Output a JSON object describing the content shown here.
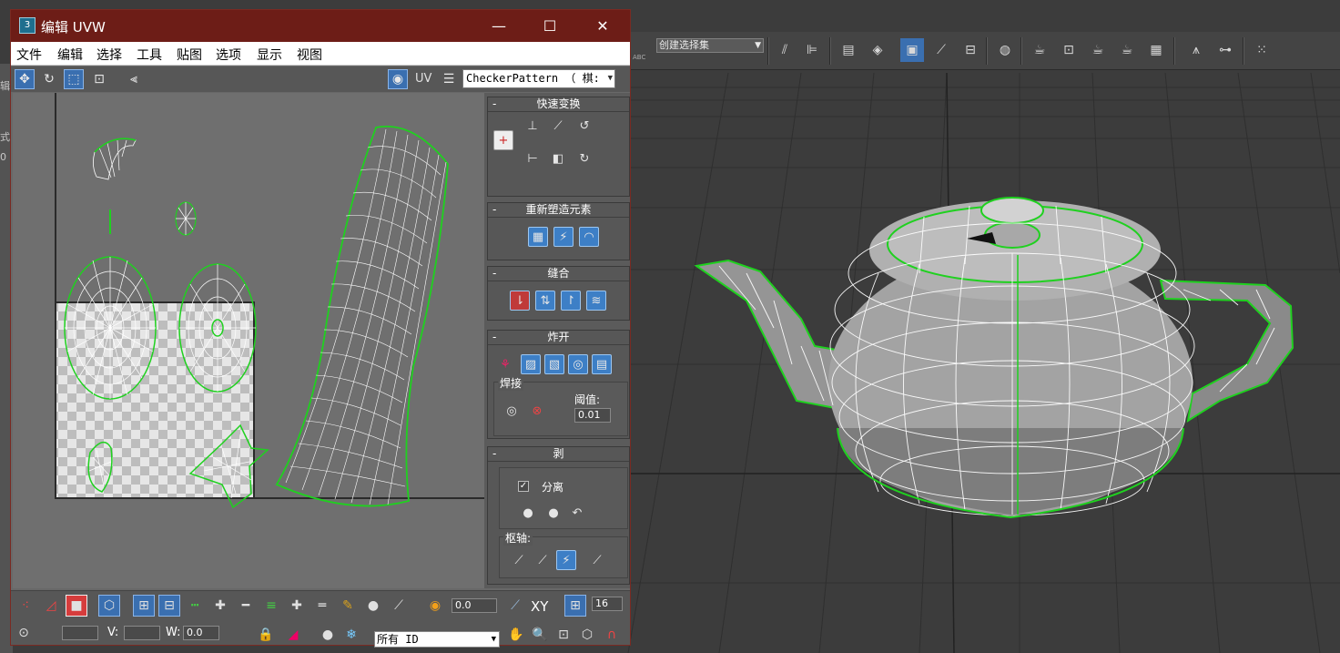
{
  "viewport": {
    "selection_set_label": "创建选择集",
    "abc_label": "ABC",
    "left_strip_labels": [
      "辑",
      "式",
      "0"
    ],
    "toolbar_icons": [
      "select-and-link-icon",
      "mirror-icon",
      "align-icon",
      "layer-manager-icon",
      "scene-explorer-icon",
      "toggle-ribbon-icon",
      "curve-editor-icon",
      "schematic-view-icon",
      "material-editor-icon",
      "render-setup-icon",
      "rendered-frame-icon",
      "render-icon",
      "render-iterative-icon",
      "render-online-icon",
      "render-viewer-icon",
      "hair-tool-icon",
      "measure-icon",
      "particle-view-icon"
    ]
  },
  "window": {
    "title": "编辑 UVW",
    "minimize": "—",
    "maximize": "☐",
    "close": "✕",
    "menu": [
      "文件",
      "编辑",
      "选择",
      "工具",
      "贴图",
      "选项",
      "显示",
      "视图"
    ],
    "uv_label": "UV",
    "checker_value": "CheckerPattern  （ 棋:"
  },
  "panel": {
    "quick_transform": "快速变换",
    "reshape": "重新塑造元素",
    "stitch": "缝合",
    "explode": "炸开",
    "weld": "焊接",
    "threshold_label": "阈值:",
    "threshold_value": "0.01",
    "peel": "剥",
    "detach_label": "分离",
    "pivot_label": "枢轴:",
    "collapse": "-"
  },
  "bottom": {
    "soft_value": "0.0",
    "xy_label": "XY",
    "grid_value": "16",
    "u_label": "",
    "v_label": "V:",
    "w_label": "W:",
    "w_value": "0.0",
    "id_select": "所有 ID"
  },
  "colors": {
    "title_bar": "#6d1d17",
    "active_blue": "#3a6fb0",
    "selection_green": "#1fd11f"
  }
}
